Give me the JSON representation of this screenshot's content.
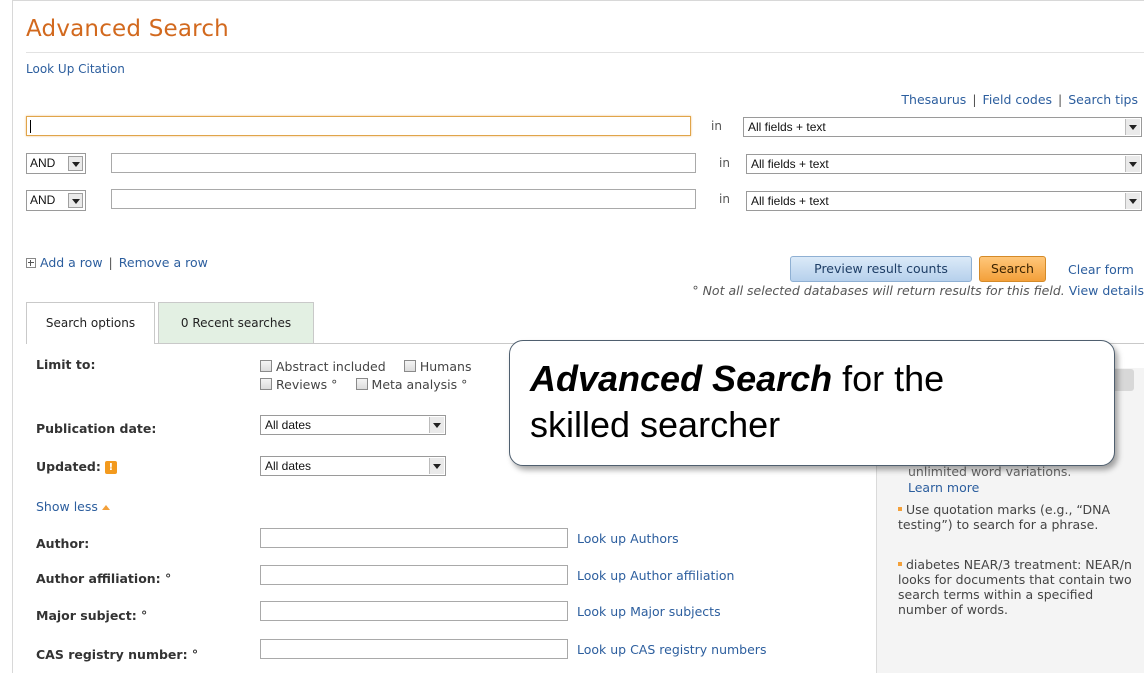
{
  "header": {
    "title": "Advanced Search",
    "lookup_citation": "Look Up Citation",
    "links": [
      "Thesaurus",
      "Field codes",
      "Search tips"
    ],
    "link_separator": "|"
  },
  "search_rows": [
    {
      "operator": "",
      "value": "",
      "in_label": "in",
      "field": "All fields + text"
    },
    {
      "operator": "AND",
      "value": "",
      "in_label": "in",
      "field": "All fields + text"
    },
    {
      "operator": "AND",
      "value": "",
      "in_label": "in",
      "field": "All fields + text"
    }
  ],
  "row_actions": {
    "add": "Add a row",
    "separator": "|",
    "remove": "Remove a row"
  },
  "buttons": {
    "preview": "Preview result counts",
    "search": "Search",
    "clear": "Clear form"
  },
  "db_note": {
    "text": "° Not all selected databases will return results for this field.",
    "link": "View details"
  },
  "tabs": {
    "options": "Search options",
    "recent": "0 Recent searches"
  },
  "options": {
    "limit_to_label": "Limit to:",
    "limit_checkboxes_row1": [
      "Abstract included",
      "Humans"
    ],
    "limit_checkboxes_row2": [
      "Reviews °",
      "Meta analysis °"
    ],
    "publication_date_label": "Publication date:",
    "publication_date_value": "All dates",
    "updated_label": "Updated:",
    "updated_badge": "!",
    "updated_value": "All dates",
    "show_less": "Show less",
    "author_label": "Author:",
    "author_lookup": "Look up Authors",
    "affiliation_label": "Author affiliation: °",
    "affiliation_lookup": "Look up Author affiliation",
    "major_subject_label": "Major subject: °",
    "major_subject_lookup": "Look up Major subjects",
    "cas_label": "CAS registry number: °",
    "cas_lookup": "Look up CAS registry numbers"
  },
  "tips": {
    "tip1_partial": "unlimited word variations.",
    "tip1_link": "Learn more",
    "tip2": "Use quotation marks (e.g., “DNA testing”) to search for a phrase.",
    "tip3": "diabetes NEAR/3 treatment: NEAR/n looks for documents that contain two search terms within a specified number of words."
  },
  "callout": {
    "bold": "Advanced Search",
    "rest1": " for the",
    "line2": "skilled searcher"
  },
  "colors": {
    "title": "#d2691e",
    "link": "#2c5e9e",
    "accent_orange": "#f3a03a",
    "preview_blue": "#b6d0ec"
  }
}
